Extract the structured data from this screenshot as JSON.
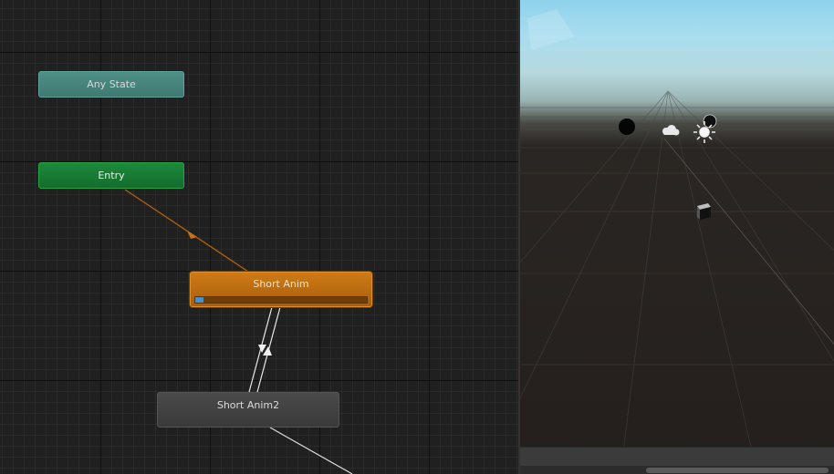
{
  "animator": {
    "states": {
      "any_state": "Any State",
      "entry": "Entry",
      "short_anim": "Short Anim",
      "short_anim2": "Short Anim2"
    },
    "short_anim_progress": 0.05,
    "colors": {
      "any_state": "#4e8f86",
      "entry": "#1d8a3b",
      "default_state": "#cf7a16",
      "state": "#4a4a4a"
    }
  },
  "scene": {
    "icons": [
      "sphere-icon",
      "cloud-icon",
      "directional-light-icon",
      "camera-icon",
      "cube-icon"
    ]
  }
}
